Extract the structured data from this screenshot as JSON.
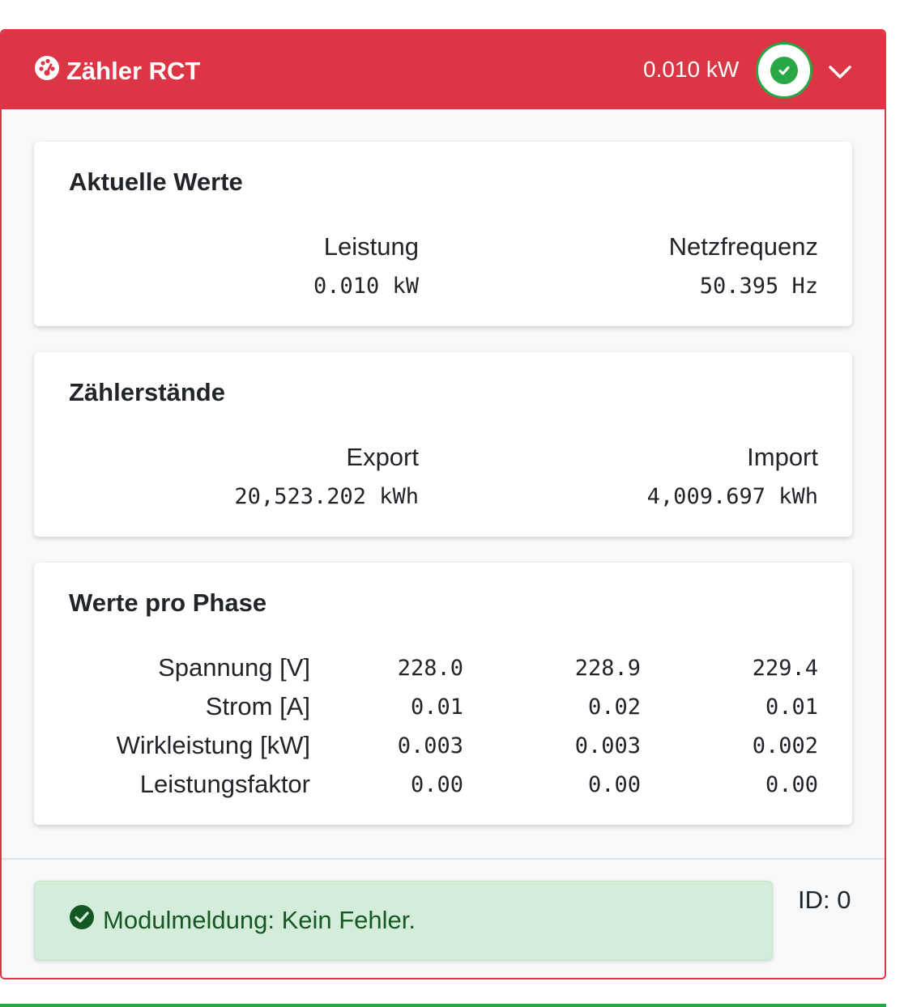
{
  "header": {
    "title": "Zähler RCT",
    "power": "0.010 kW",
    "icon": "meter-icon",
    "status_icon": "check-circle-icon",
    "toggle_icon": "chevron-down-icon"
  },
  "current_values": {
    "title": "Aktuelle Werte",
    "power_label": "Leistung",
    "power_value": "0.010 kW",
    "frequency_label": "Netzfrequenz",
    "frequency_value": "50.395 Hz"
  },
  "counters": {
    "title": "Zählerstände",
    "export_label": "Export",
    "export_value": "20,523.202 kWh",
    "import_label": "Import",
    "import_value": "4,009.697 kWh"
  },
  "phases": {
    "title": "Werte pro Phase",
    "rows": [
      {
        "label": "Spannung [V]",
        "values": [
          "228.0",
          "228.9",
          "229.4"
        ]
      },
      {
        "label": "Strom [A]",
        "values": [
          "0.01",
          "0.02",
          "0.01"
        ]
      },
      {
        "label": "Wirkleistung [kW]",
        "values": [
          "0.003",
          "0.003",
          "0.002"
        ]
      },
      {
        "label": "Leistungsfaktor",
        "values": [
          "0.00",
          "0.00",
          "0.00"
        ]
      }
    ]
  },
  "footer": {
    "message": "Modulmeldung: Kein Fehler.",
    "id_text": "ID: 0"
  },
  "colors": {
    "header_bg": "#dc3545",
    "success": "#28a745",
    "alert_bg": "#d4edda",
    "alert_text": "#155724"
  }
}
